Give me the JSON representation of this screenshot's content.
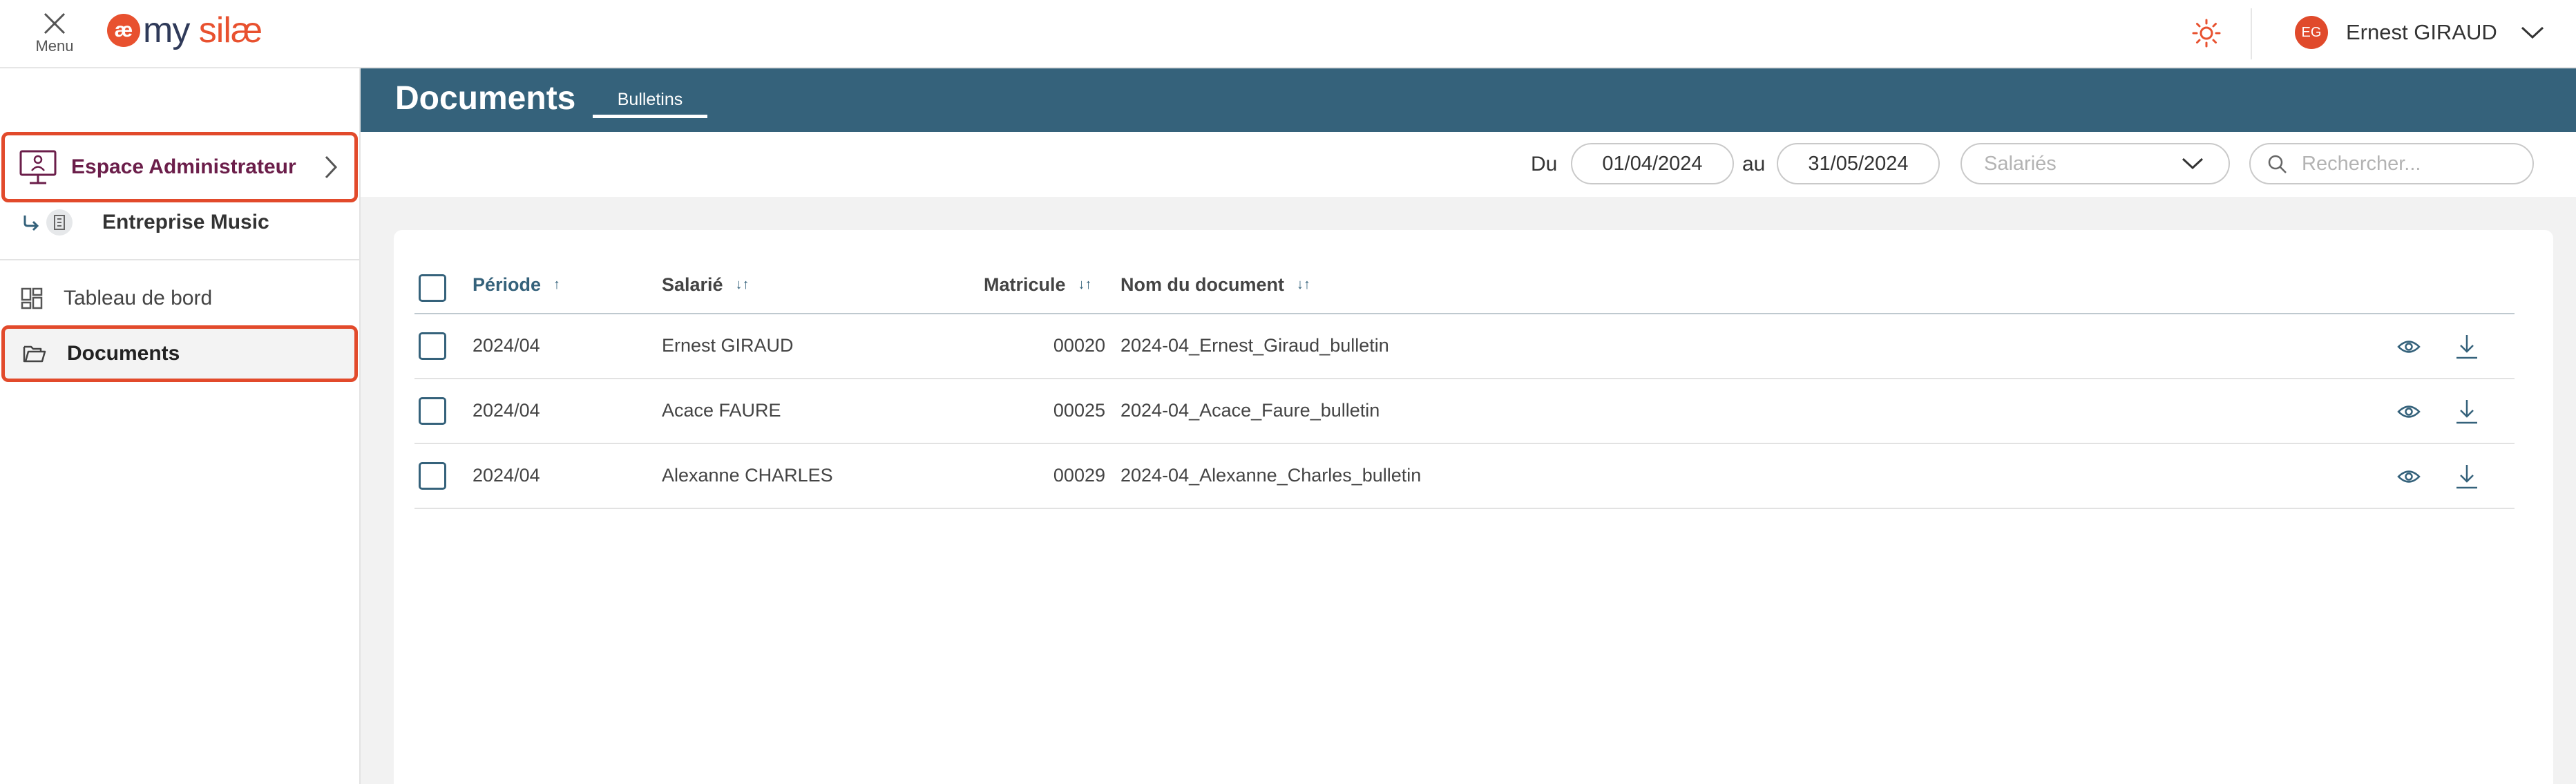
{
  "topbar": {
    "menu_label": "Menu",
    "logo_mark": "æ",
    "logo_my": "my",
    "logo_brand": " silæ",
    "user_initials": "EG",
    "user_name": "Ernest GIRAUD"
  },
  "sidebar": {
    "admin_label": "Espace Administrateur",
    "company_label": "Entreprise Music",
    "items": [
      {
        "label": "Tableau de bord"
      },
      {
        "label": "Documents"
      }
    ]
  },
  "header": {
    "title": "Documents",
    "tab": "Bulletins"
  },
  "filters": {
    "from_label": "Du",
    "from_value": "01/04/2024",
    "to_label": "au",
    "to_value": "31/05/2024",
    "employees_placeholder": "Salariés",
    "search_placeholder": "Rechercher..."
  },
  "table": {
    "columns": {
      "period": "Période",
      "employee": "Salarié",
      "matricule": "Matricule",
      "document": "Nom du document"
    },
    "sort_icons": {
      "asc": "↑",
      "both": "↓↑"
    },
    "rows": [
      {
        "period": "2024/04",
        "employee": "Ernest GIRAUD",
        "matricule": "00020",
        "document": "2024-04_Ernest_Giraud_bulletin"
      },
      {
        "period": "2024/04",
        "employee": "Acace FAURE",
        "matricule": "00025",
        "document": "2024-04_Acace_Faure_bulletin"
      },
      {
        "period": "2024/04",
        "employee": "Alexanne CHARLES",
        "matricule": "00029",
        "document": "2024-04_Alexanne_Charles_bulletin"
      }
    ]
  },
  "colors": {
    "accent": "#e8512f",
    "header": "#35627b",
    "highlight_border": "#e24a2b"
  }
}
